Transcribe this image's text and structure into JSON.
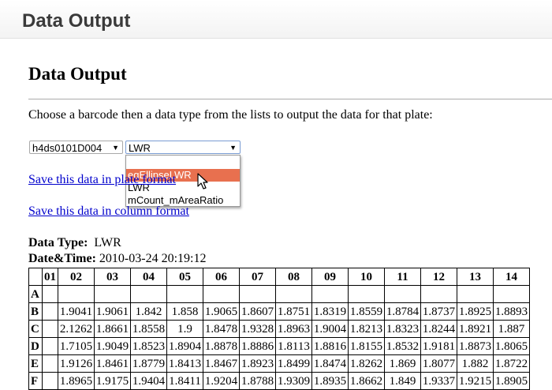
{
  "app": {
    "title": "Data Output"
  },
  "page": {
    "title": "Data Output",
    "instructions": "Choose a barcode then a data type from the lists to output the data for that plate:"
  },
  "barcode_select": {
    "value": "h4ds0101D004"
  },
  "type_select": {
    "value": "LWR",
    "options": [
      "",
      "eqEllipseLWR",
      "LWR",
      "mCount_mAreaRatio"
    ],
    "highlighted": "eqEllipseLWR"
  },
  "links": {
    "save_plate": "Save this data in plate format",
    "save_column": "Save this data in column format"
  },
  "info": {
    "data_type_label": "Data Type:",
    "data_type_value": "LWR",
    "datetime_label": "Date&Time:",
    "datetime_value": "2010-03-24 20:19:12"
  },
  "table": {
    "columns": [
      "01",
      "02",
      "03",
      "04",
      "05",
      "06",
      "07",
      "08",
      "09",
      "10",
      "11",
      "12",
      "13",
      "14"
    ],
    "rows": [
      {
        "label": "A",
        "cells": [
          "",
          "",
          "",
          "",
          "",
          "",
          "",
          "",
          "",
          "",
          "",
          "",
          "",
          ""
        ]
      },
      {
        "label": "B",
        "cells": [
          "",
          "1.9041",
          "1.9061",
          "1.842",
          "1.858",
          "1.9065",
          "1.8607",
          "1.8751",
          "1.8319",
          "1.8559",
          "1.8784",
          "1.8737",
          "1.8925",
          "1.8893"
        ]
      },
      {
        "label": "C",
        "cells": [
          "",
          "2.1262",
          "1.8661",
          "1.8558",
          "1.9",
          "1.8478",
          "1.9328",
          "1.8963",
          "1.9004",
          "1.8213",
          "1.8323",
          "1.8244",
          "1.8921",
          "1.887"
        ]
      },
      {
        "label": "D",
        "cells": [
          "",
          "1.7105",
          "1.9049",
          "1.8523",
          "1.8904",
          "1.8878",
          "1.8886",
          "1.8113",
          "1.8816",
          "1.8155",
          "1.8532",
          "1.9181",
          "1.8873",
          "1.8065"
        ]
      },
      {
        "label": "E",
        "cells": [
          "",
          "1.9126",
          "1.8461",
          "1.8779",
          "1.8413",
          "1.8467",
          "1.8923",
          "1.8499",
          "1.8474",
          "1.8262",
          "1.869",
          "1.8077",
          "1.882",
          "1.8722"
        ]
      },
      {
        "label": "F",
        "cells": [
          "",
          "1.8965",
          "1.9175",
          "1.9404",
          "1.8411",
          "1.9204",
          "1.8788",
          "1.9309",
          "1.8935",
          "1.8662",
          "1.849",
          "1.9337",
          "1.9215",
          "1.8905"
        ]
      }
    ]
  },
  "colors": {
    "highlight": "#e8704f",
    "link": "#0000cc"
  }
}
